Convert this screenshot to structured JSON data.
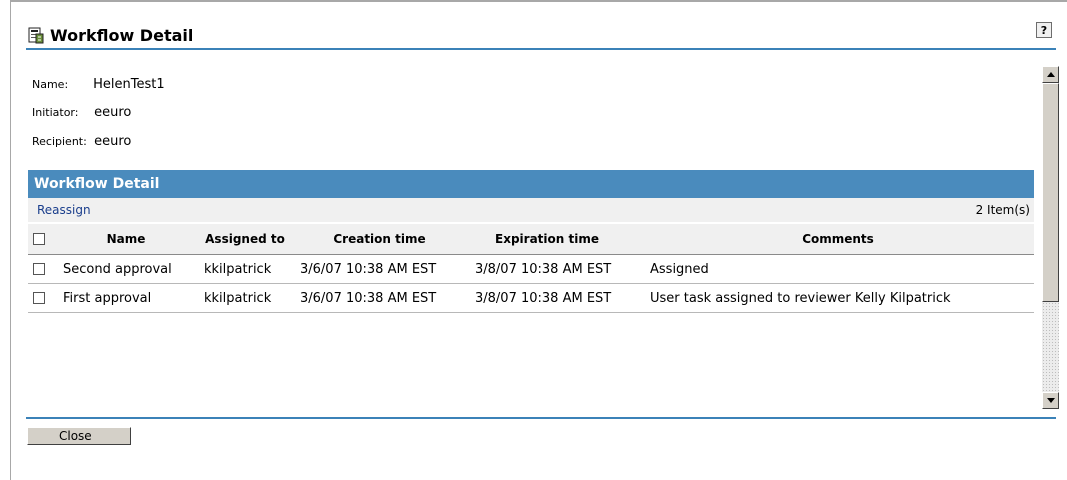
{
  "window": {
    "title": "Workflow Detail",
    "help_label": "?"
  },
  "info": {
    "name_label": "Name:",
    "name_value": "HelenTest1",
    "initiator_label": "Initiator:",
    "initiator_value": "eeuro",
    "recipient_label": "Recipient:",
    "recipient_value": "eeuro"
  },
  "section": {
    "title": "Workflow Detail",
    "reassign_label": "Reassign",
    "item_count": "2 Item(s)"
  },
  "table": {
    "columns": [
      "Name",
      "Assigned to",
      "Creation time",
      "Expiration time",
      "Comments"
    ],
    "rows": [
      {
        "name": "Second approval",
        "assigned_to": "kkilpatrick",
        "creation_time": "3/6/07 10:38 AM EST",
        "expiration_time": "3/8/07 10:38 AM EST",
        "comments": "Assigned"
      },
      {
        "name": "First approval",
        "assigned_to": "kkilpatrick",
        "creation_time": "3/6/07 10:38 AM EST",
        "expiration_time": "3/8/07 10:38 AM EST",
        "comments": "User task assigned to reviewer Kelly Kilpatrick"
      }
    ]
  },
  "footer": {
    "close_label": "Close"
  },
  "colors": {
    "accent": "#4a8bbd",
    "rule": "#3b82b8",
    "link": "#1a3e8c"
  },
  "icons": {
    "title": "workflow-icon",
    "help": "help-icon",
    "scroll_up": "arrow-up-icon",
    "scroll_down": "arrow-down-icon"
  }
}
